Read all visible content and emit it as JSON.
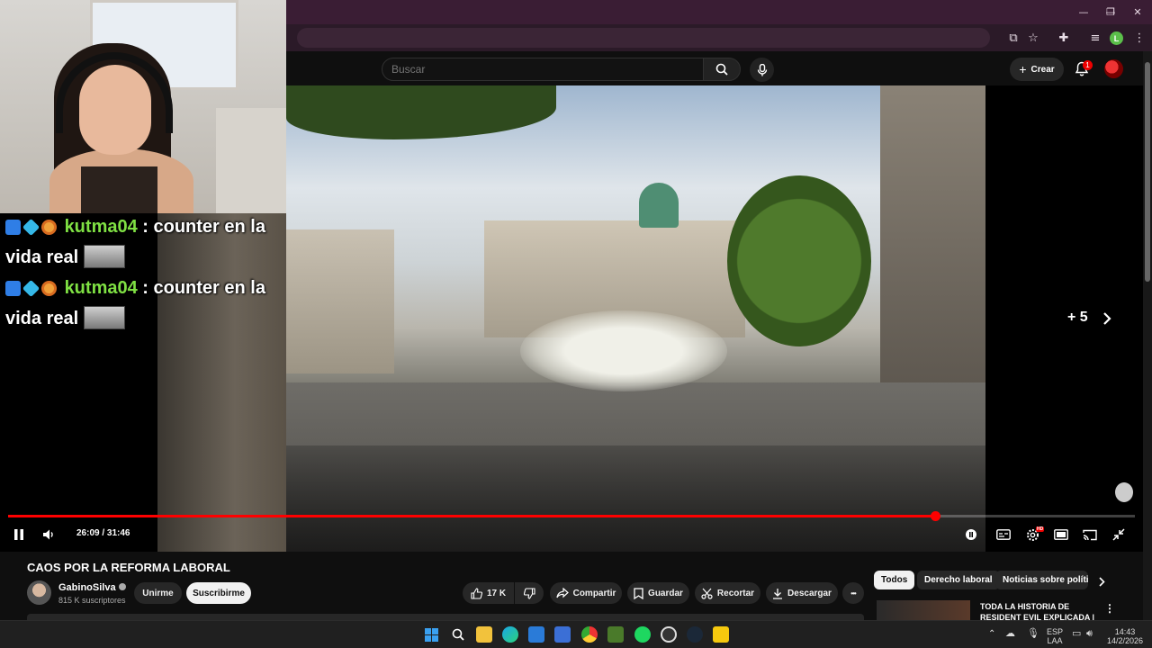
{
  "browser": {
    "window_controls": {
      "minimize": "—",
      "restore": "❐",
      "close": "✕"
    },
    "profile_initial": "L"
  },
  "youtube": {
    "search": {
      "placeholder": "Buscar"
    },
    "create_label": "Crear",
    "notifications_count": "1"
  },
  "player": {
    "current_time": "26:09",
    "duration": "31:46",
    "time_display": "26:09 / 31:46",
    "progress_fraction": 0.823,
    "more_photos_label": "+ 5",
    "hd_badge": "HD"
  },
  "stream_overlay": {
    "chat": [
      {
        "user": "kutma04",
        "message": ": counter en la",
        "continuation": "vida real"
      },
      {
        "user": "kutma04",
        "message": ": counter en la",
        "continuation": "vida real"
      }
    ]
  },
  "video": {
    "title": "CAOS POR LA REFORMA LABORAL",
    "channel": {
      "name": "GabinoSilva",
      "subscribers": "815 K suscriptores"
    },
    "join_label": "Unirme",
    "subscribe_label": "Suscribirme",
    "likes": "17 K",
    "share_label": "Compartir",
    "save_label": "Guardar",
    "clip_label": "Recortar",
    "download_label": "Descargar",
    "more_label": "•••"
  },
  "sidebar": {
    "chips": [
      "Todos",
      "Derecho laboral",
      "Noticias sobre polític"
    ],
    "related": [
      {
        "title": "TODA LA HISTORIA DE RESIDENT EVIL EXPLICADA |"
      }
    ]
  },
  "taskbar": {
    "language": "ESP",
    "language_sub": "LAA",
    "time": "14:43",
    "date": "14/2/2026"
  },
  "colors": {
    "accent_red": "#ff0000",
    "chrome_bg": "#3a1d34",
    "chat_username": "#7fe043"
  }
}
